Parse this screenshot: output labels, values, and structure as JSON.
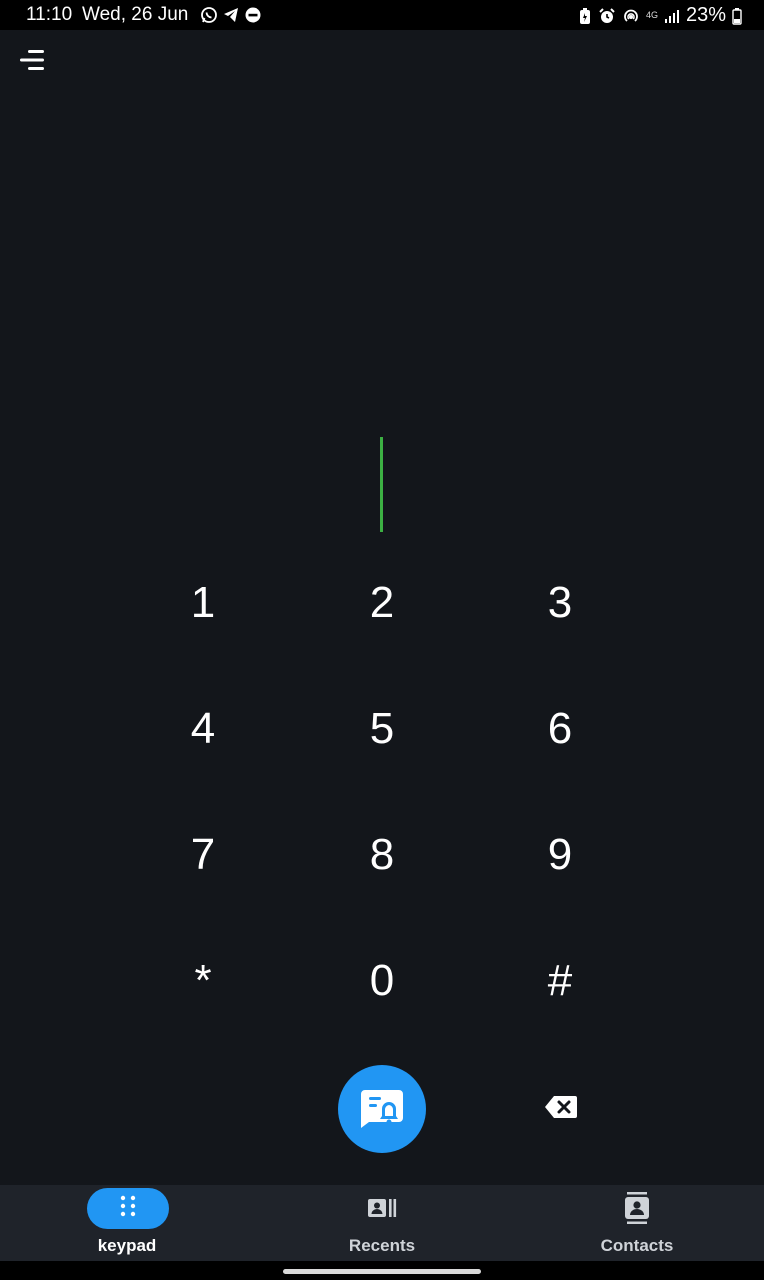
{
  "status_bar": {
    "time": "11:10",
    "date": "Wed, 26 Jun",
    "battery_percent": "23%",
    "network_label": "4G",
    "notification_icons": [
      "whatsapp-icon",
      "telegram-icon",
      "dnd-icon"
    ],
    "system_icons": [
      "battery-saver-icon",
      "alarm-icon",
      "hotspot-icon",
      "signal-icon",
      "battery-icon"
    ]
  },
  "header": {
    "menu_icon": "menu-icon"
  },
  "dialer": {
    "input_value": "",
    "cursor_color": "#3cb043",
    "keys": [
      "1",
      "2",
      "3",
      "4",
      "5",
      "6",
      "7",
      "8",
      "9",
      "*",
      "0",
      "#"
    ],
    "call_button_icon": "message-bell-icon",
    "backspace_icon": "backspace-icon"
  },
  "bottom_nav": {
    "items": [
      {
        "label": "keypad",
        "icon": "dialpad-icon",
        "active": true
      },
      {
        "label": "Recents",
        "icon": "recents-icon",
        "active": false
      },
      {
        "label": "Contacts",
        "icon": "contacts-icon",
        "active": false
      }
    ]
  },
  "colors": {
    "background": "#13161b",
    "accent": "#2196f3",
    "nav_background": "#1f232a"
  }
}
